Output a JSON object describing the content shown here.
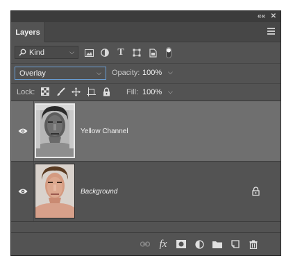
{
  "panel": {
    "title_tab": "Layers",
    "top_controls": [
      "««",
      "✕"
    ]
  },
  "filter": {
    "kind_label": "Kind",
    "icons": [
      "image-filter-icon",
      "adjustment-filter-icon",
      "type-filter-icon",
      "shape-filter-icon",
      "smart-object-filter-icon",
      "filter-toggle-icon"
    ]
  },
  "blend": {
    "mode": "Overlay",
    "opacity_label": "Opacity:",
    "opacity_value": "100%"
  },
  "locks": {
    "label": "Lock:",
    "icons": [
      "lock-transparent-pixels-icon",
      "lock-image-pixels-icon",
      "lock-position-icon",
      "lock-artboard-icon",
      "lock-all-icon"
    ],
    "fill_label": "Fill:",
    "fill_value": "100%"
  },
  "layers": [
    {
      "name": "Yellow Channel",
      "selected": true,
      "visible": true,
      "locked": false
    },
    {
      "name": "Background",
      "selected": false,
      "visible": true,
      "locked": true
    }
  ],
  "bottom_icons": [
    "link-layers-icon",
    "fx-icon",
    "add-mask-icon",
    "new-adjustment-icon",
    "new-group-icon",
    "new-layer-icon",
    "delete-layer-icon"
  ],
  "bottom_labels": {
    "fx": "fx"
  },
  "colors": {
    "panel_bg": "#535353",
    "selected_row": "#6f6f6f",
    "focus_border": "#6a9fd6"
  }
}
